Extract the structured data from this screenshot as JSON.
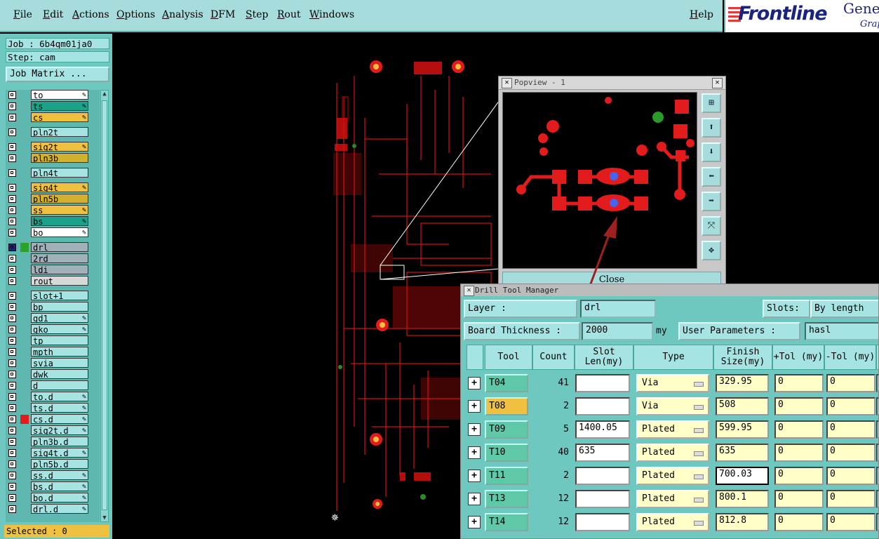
{
  "menu": {
    "items": [
      "File",
      "Edit",
      "Actions",
      "Options",
      "Analysis",
      "DFM",
      "Step",
      "Rout",
      "Windows"
    ],
    "help": "Help"
  },
  "logo": {
    "brand": "Frontline",
    "gen": "Gene",
    "graph": "Grap"
  },
  "job": {
    "job_line": "Job : 6b4qm01ja0",
    "step_line": "Step: cam",
    "matrix_button": "Job Matrix ..."
  },
  "layers": [
    {
      "name": "to",
      "color": "#ffffff",
      "pen": true
    },
    {
      "name": "ts",
      "color": "#1aa38a",
      "pen": true
    },
    {
      "name": "cs",
      "color": "#f0c040",
      "pen": true
    },
    {
      "name": "pln2t",
      "color": "#a6e3e3",
      "pen": false
    },
    {
      "name": "sig2t",
      "color": "#f0c040",
      "pen": true
    },
    {
      "name": "pln3b",
      "color": "#d4b030",
      "pen": false
    },
    {
      "name": "pln4t",
      "color": "#a6e3e3",
      "pen": false
    },
    {
      "name": "sig4t",
      "color": "#f0c040",
      "pen": true
    },
    {
      "name": "pln5b",
      "color": "#d4b030",
      "pen": false
    },
    {
      "name": "ss",
      "color": "#f0c040",
      "pen": true
    },
    {
      "name": "bs",
      "color": "#1aa38a",
      "pen": true
    },
    {
      "name": "bo",
      "color": "#ffffff",
      "pen": true
    },
    {
      "name": "drl",
      "color": "#a0b0b8",
      "pen": false
    },
    {
      "name": "2rd",
      "color": "#a0b0b8",
      "pen": false
    },
    {
      "name": "ldi",
      "color": "#a0b0b8",
      "pen": false
    },
    {
      "name": "rout",
      "color": "#d8d8d8",
      "pen": false
    },
    {
      "name": "slot+1",
      "color": "#a6e3e3",
      "pen": false
    },
    {
      "name": "bp",
      "color": "#a6e3e3",
      "pen": false
    },
    {
      "name": "gd1",
      "color": "#a6e3e3",
      "pen": true
    },
    {
      "name": "gko",
      "color": "#a6e3e3",
      "pen": true
    },
    {
      "name": "tp",
      "color": "#a6e3e3",
      "pen": false
    },
    {
      "name": "mpth",
      "color": "#a6e3e3",
      "pen": false
    },
    {
      "name": "svia",
      "color": "#a6e3e3",
      "pen": false
    },
    {
      "name": "dwk",
      "color": "#a6e3e3",
      "pen": false
    },
    {
      "name": "d",
      "color": "#a6e3e3",
      "pen": false
    },
    {
      "name": "to.d",
      "color": "#a6e3e3",
      "pen": true
    },
    {
      "name": "ts.d",
      "color": "#a6e3e3",
      "pen": true
    },
    {
      "name": "cs.d",
      "color": "#a6e3e3",
      "pen": true
    },
    {
      "name": "sig2t.d",
      "color": "#a6e3e3",
      "pen": true
    },
    {
      "name": "pln3b.d",
      "color": "#a6e3e3",
      "pen": false
    },
    {
      "name": "sig4t.d",
      "color": "#a6e3e3",
      "pen": true
    },
    {
      "name": "pln5b.d",
      "color": "#a6e3e3",
      "pen": false
    },
    {
      "name": "ss.d",
      "color": "#a6e3e3",
      "pen": true
    },
    {
      "name": "bs.d",
      "color": "#a6e3e3",
      "pen": true
    },
    {
      "name": "bo.d",
      "color": "#a6e3e3",
      "pen": true
    },
    {
      "name": "drl.d",
      "color": "#a6e3e3",
      "pen": true
    }
  ],
  "selected": "Selected : 0",
  "popview": {
    "title": "Popview - 1",
    "close": "Close"
  },
  "dtm": {
    "title": "Drill Tool Manager",
    "layer_label": "Layer :",
    "layer_value": "drl",
    "slots_label": "Slots:",
    "slots_value": "By length",
    "thickness_label": "Board Thickness :",
    "thickness_value": "2000",
    "thickness_unit": "my",
    "user_params_label": "User Parameters :",
    "user_params_value": "hasl",
    "headers": [
      "Tool",
      "Count",
      "Slot Len(my)",
      "Type",
      "Finish Size(my)",
      "+Tol (my)",
      "-Tol (my)"
    ],
    "rows": [
      {
        "tool": "T04",
        "count": "41",
        "slot": "",
        "type": "Via",
        "finish": "329.95",
        "ptol": "0",
        "mtol": "0"
      },
      {
        "tool": "T08",
        "count": "2",
        "slot": "",
        "type": "Via",
        "finish": "508",
        "ptol": "0",
        "mtol": "0"
      },
      {
        "tool": "T09",
        "count": "5",
        "slot": "1400.05",
        "type": "Plated",
        "finish": "599.95",
        "ptol": "0",
        "mtol": "0"
      },
      {
        "tool": "T10",
        "count": "40",
        "slot": "635",
        "type": "Plated",
        "finish": "635",
        "ptol": "0",
        "mtol": "0"
      },
      {
        "tool": "T11",
        "count": "2",
        "slot": "",
        "type": "Plated",
        "finish": "700.03",
        "ptol": "0",
        "mtol": "0"
      },
      {
        "tool": "T13",
        "count": "12",
        "slot": "",
        "type": "Plated",
        "finish": "800.1",
        "ptol": "0",
        "mtol": "0"
      },
      {
        "tool": "T14",
        "count": "12",
        "slot": "",
        "type": "Plated",
        "finish": "812.8",
        "ptol": "0",
        "mtol": "0"
      }
    ]
  }
}
